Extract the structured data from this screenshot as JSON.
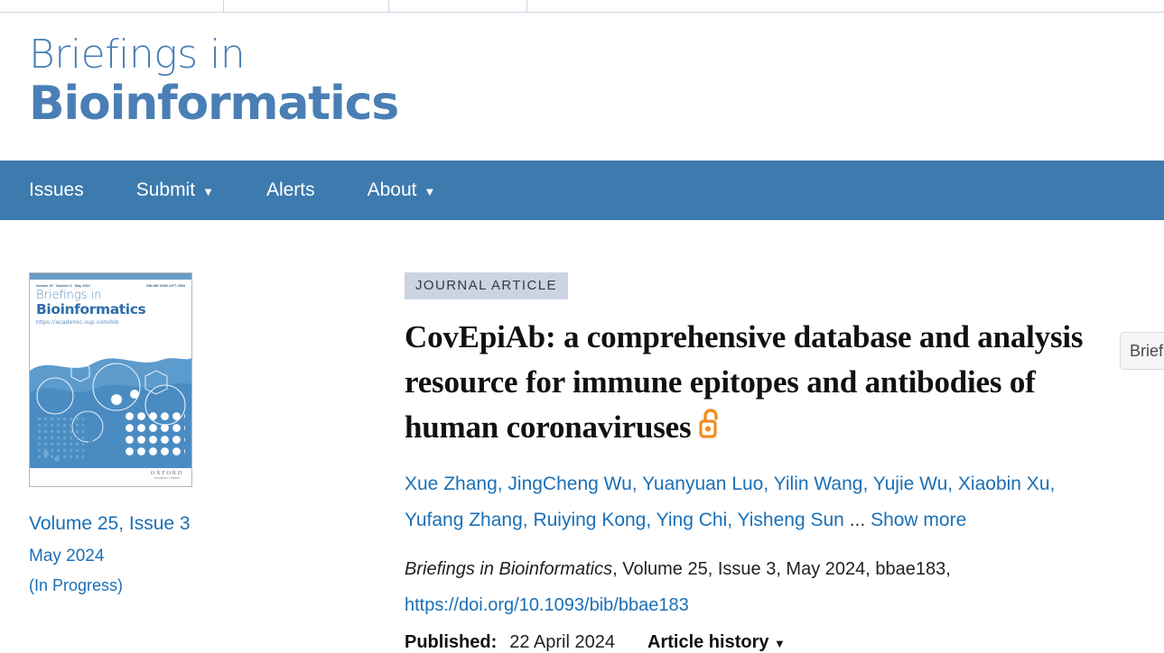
{
  "colors": {
    "nav_blue": "#3d7aad",
    "logo_blue": "#4a7fb5",
    "link_blue": "#1b6fb5",
    "badge_bg": "#ccd4e4",
    "open_access_orange": "#f28b20"
  },
  "topbar": {
    "divider_positions": [
      247,
      430,
      583
    ]
  },
  "masthead": {
    "logo_line1": "Briefings in",
    "logo_line2": "Bioinformatics"
  },
  "nav": {
    "items": [
      {
        "label": "Issues",
        "has_caret": false
      },
      {
        "label": "Submit",
        "has_caret": true
      },
      {
        "label": "Alerts",
        "has_caret": false
      },
      {
        "label": "About",
        "has_caret": true
      }
    ],
    "search_value": "Briefin"
  },
  "cover": {
    "meta_left": "Volume 25 · Number 3 · May 2024",
    "meta_right": "ONLINE ISSN 1477-4054",
    "title_line1": "Briefings in",
    "title_line2": "Bioinformatics",
    "url": "https://academic.oup.com/bib",
    "publisher_line1": "OXFORD",
    "publisher_line2": "UNIVERSITY PRESS"
  },
  "issue": {
    "volume_issue": "Volume 25, Issue 3",
    "date": "May 2024",
    "status": "(In Progress)"
  },
  "article": {
    "type_badge": "JOURNAL ARTICLE",
    "title": "CovEpiAb: a comprehensive database and analysis resource for immune epitopes and antibodies of human coronaviruses",
    "open_access_icon": "open-access-lock-icon",
    "authors": [
      "Xue Zhang",
      "JingCheng Wu",
      "Yuanyuan Luo",
      "Yilin Wang",
      "Yujie Wu",
      "Xiaobin Xu",
      "Yufang Zhang",
      "Ruiying Kong",
      "Ying Chi",
      "Yisheng Sun"
    ],
    "authors_line1": "Xue Zhang, JingCheng Wu, Yuanyuan Luo, Yilin Wang, Yujie Wu, Xiaobin Xu,",
    "authors_line2": "Yufang Zhang, Ruiying Kong, Ying Chi, Yisheng Sun",
    "authors_ellipsis": "...",
    "show_more_label": "Show more",
    "citation": {
      "journal": "Briefings in Bioinformatics",
      "rest": ", Volume 25, Issue 3, May 2024, bbae183,"
    },
    "doi": "https://doi.org/10.1093/bib/bbae183",
    "published_label": "Published:",
    "published_date": "22 April 2024",
    "article_history_label": "Article history",
    "caret_glyph": "▼"
  }
}
